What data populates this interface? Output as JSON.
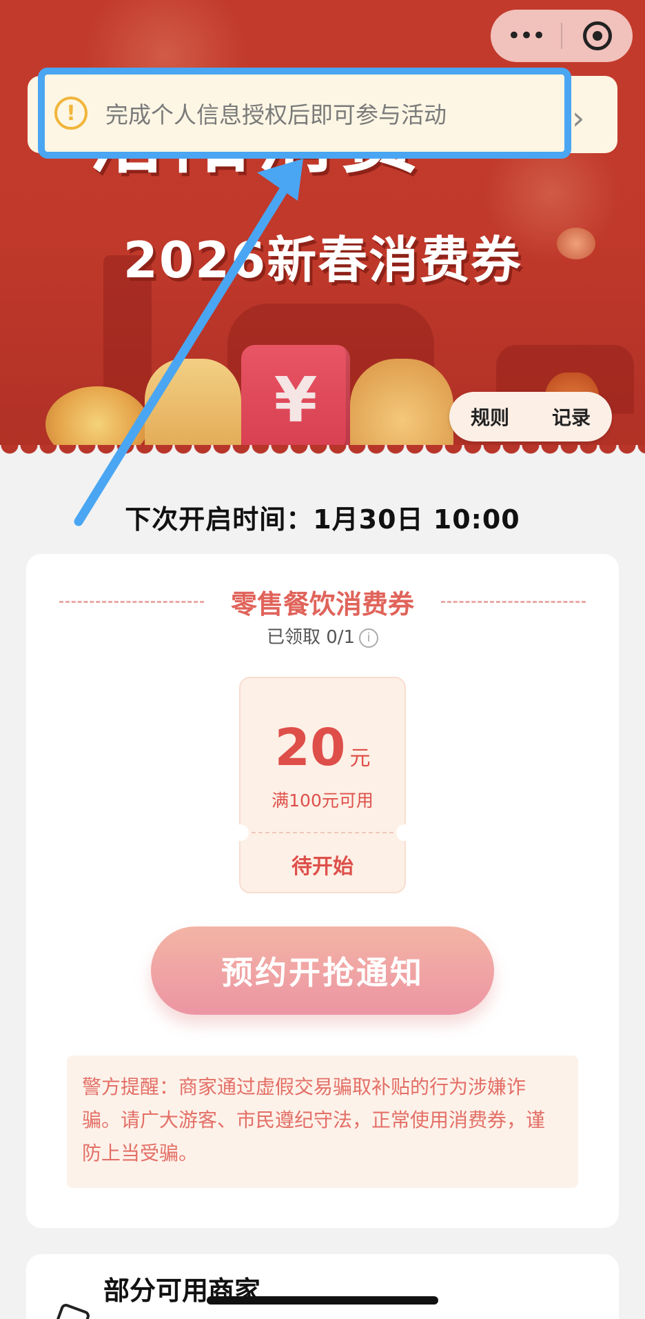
{
  "header": {
    "title_partial": "洛阳消费",
    "subtitle": "2026新春消费券"
  },
  "capsule": {
    "more_icon": "more-icon",
    "close_icon": "target-icon"
  },
  "notice": {
    "icon": "warning-icon",
    "text": "完成个人信息授权后即可参与活动",
    "chevron": "›"
  },
  "actions": {
    "rules_label": "规则",
    "records_label": "记录"
  },
  "banner": {
    "ticket_symbol": "¥"
  },
  "schedule": {
    "next_open": "下次开启时间：1月30日 10:00"
  },
  "coupon_section": {
    "title": "零售餐饮消费券",
    "claimed": "已领取 0/1",
    "coupon": {
      "amount": "20",
      "unit": "元",
      "condition": "满100元可用",
      "status": "待开始"
    },
    "reserve_button": "预约开抢通知",
    "police_notice": "警方提醒：商家通过虚假交易骗取补贴的行为涉嫌诈骗。请广大游客、市民遵纪守法，正常使用消费券，谨防上当受骗。"
  },
  "merchants": {
    "title": "部分可用商家"
  },
  "colors": {
    "banner_red": "#c0392b",
    "highlight_blue": "#4aa6f2",
    "accent_red": "#de4f4a",
    "button_pink": "#ec95a3"
  }
}
